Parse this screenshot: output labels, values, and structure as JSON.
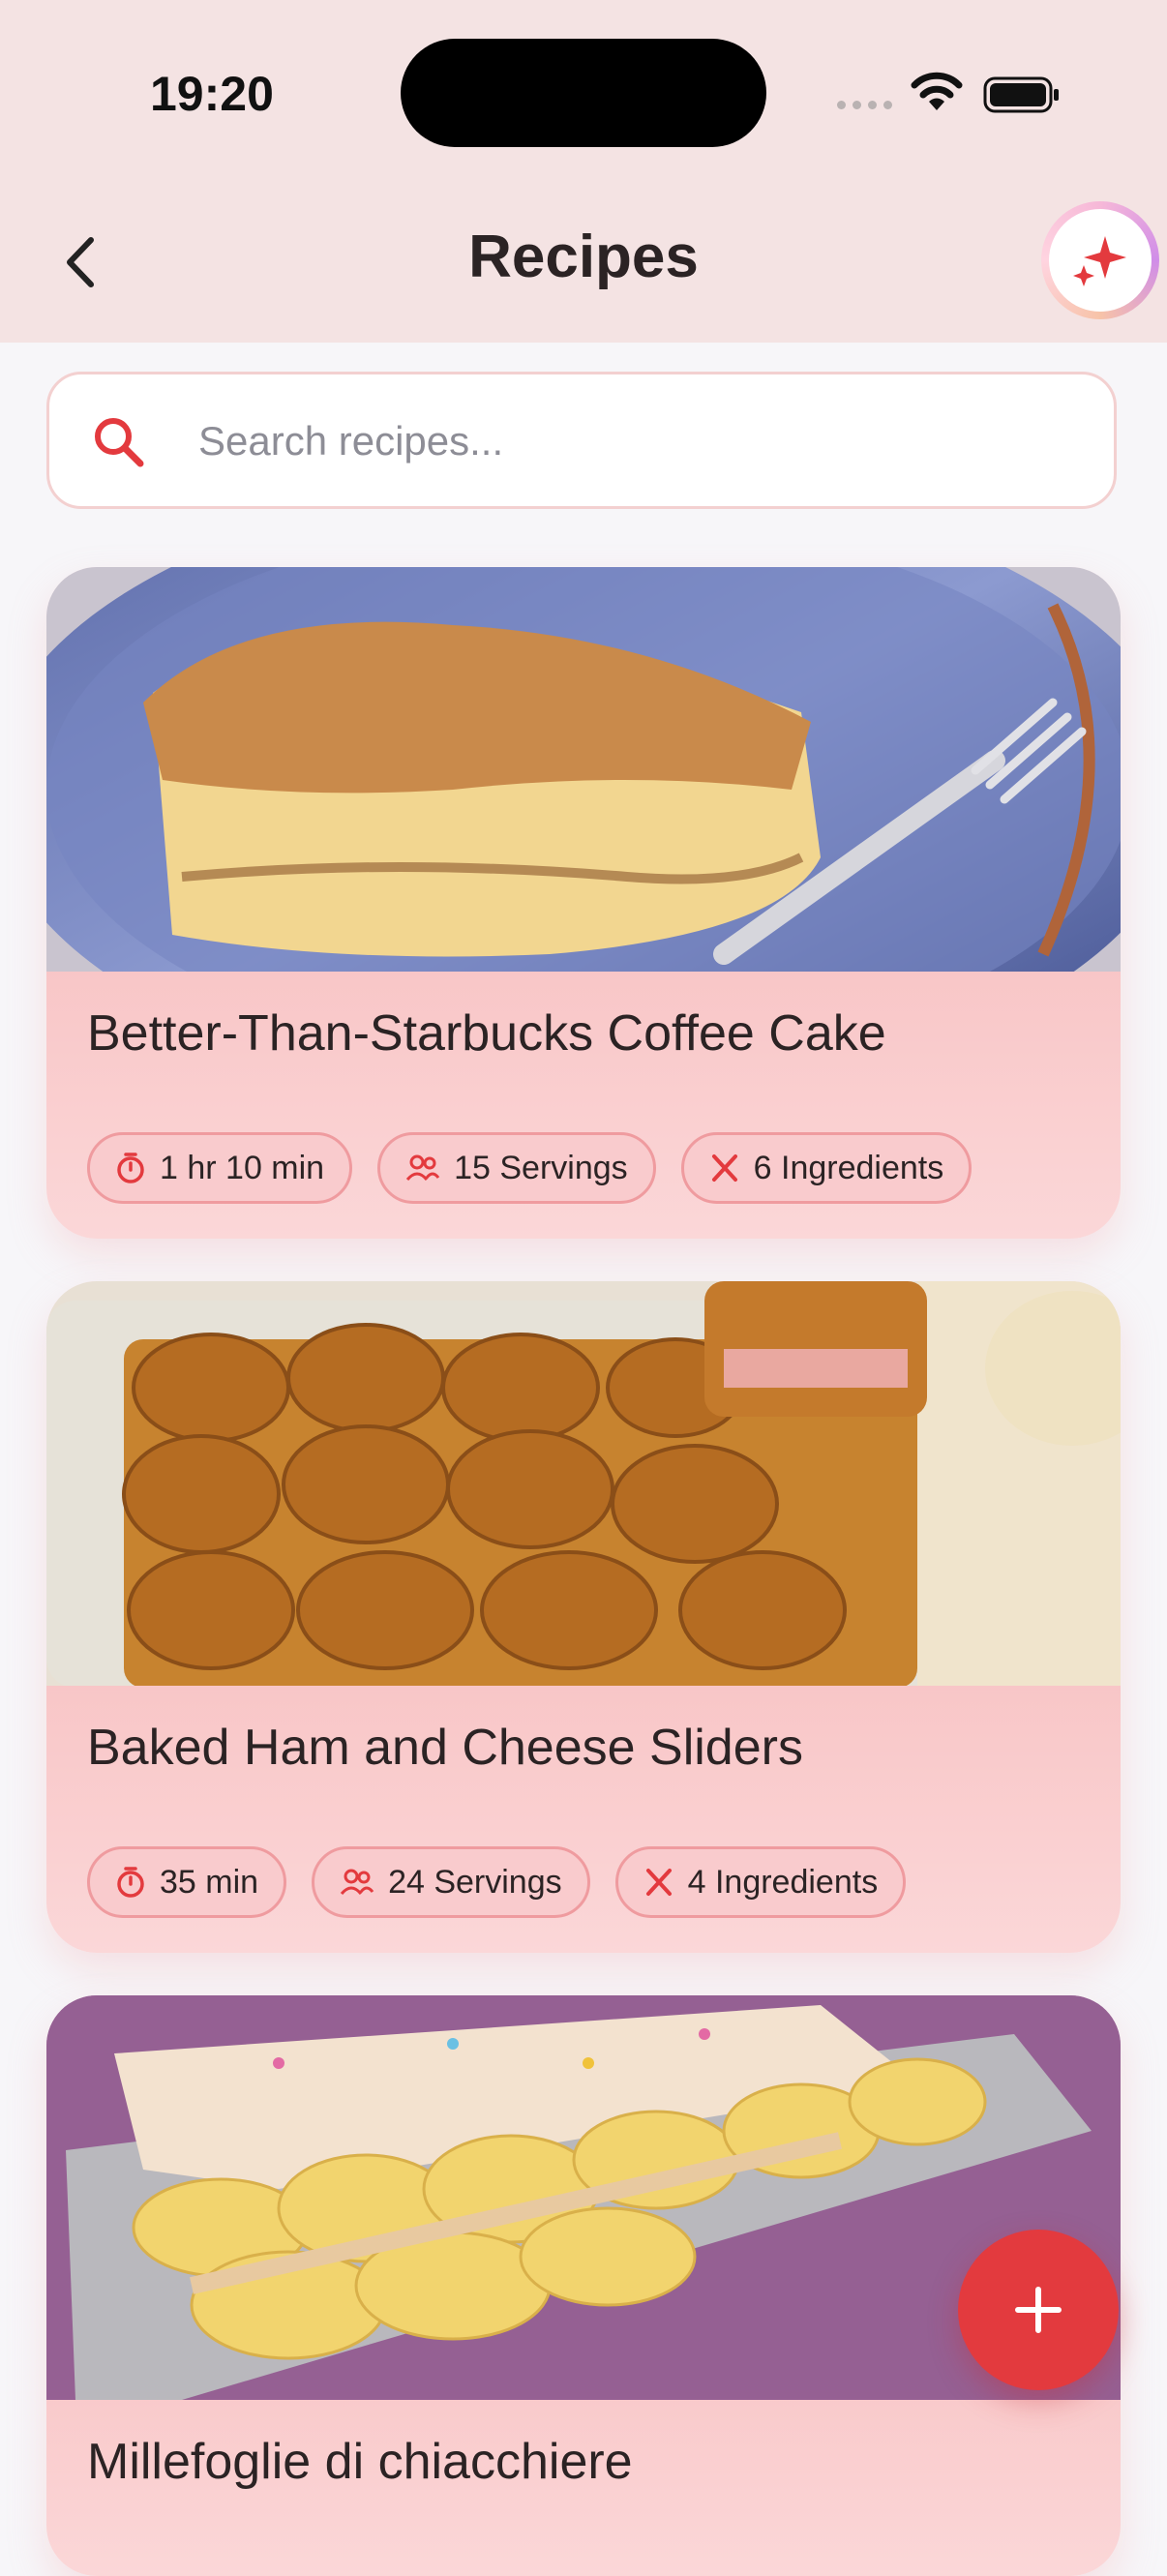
{
  "status_bar": {
    "time": "19:20"
  },
  "header": {
    "title": "Recipes"
  },
  "search": {
    "placeholder": "Search recipes..."
  },
  "recipes": [
    {
      "title": "Better-Than-Starbucks Coffee Cake",
      "time": "1 hr 10 min",
      "servings": "15 Servings",
      "ingredients": "6 Ingredients"
    },
    {
      "title": "Baked Ham and Cheese Sliders",
      "time": "35 min",
      "servings": "24 Servings",
      "ingredients": "4 Ingredients"
    },
    {
      "title": "Millefoglie di chiacchiere"
    }
  ],
  "icons": {
    "back": "chevron-left-icon",
    "ai": "sparkles-icon",
    "search": "search-icon",
    "time": "timer-icon",
    "servings": "users-icon",
    "ingredients": "utensils-icon",
    "add": "plus-icon"
  },
  "colors": {
    "accent": "#e33a3e",
    "header_bg": "#f4e3e3",
    "card_bg": "#f8c4c5"
  }
}
